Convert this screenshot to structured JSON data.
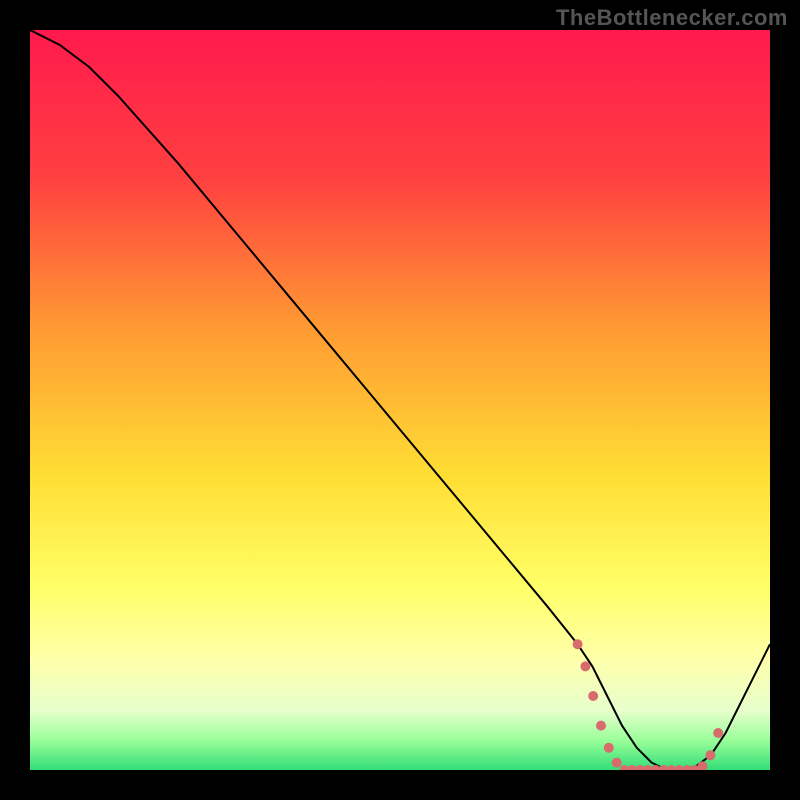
{
  "watermark": "TheBottlenecker.com",
  "chart_data": {
    "type": "line",
    "title": "",
    "xlabel": "",
    "ylabel": "",
    "xlim": [
      0,
      100
    ],
    "ylim": [
      0,
      100
    ],
    "series": [
      {
        "name": "curve",
        "x": [
          0,
          4,
          8,
          12,
          20,
          30,
          40,
          50,
          60,
          70,
          74,
          76,
          78,
          80,
          82,
          84,
          86,
          88,
          90,
          92,
          94,
          100
        ],
        "values": [
          100,
          98,
          95,
          91,
          82,
          70,
          58,
          46,
          34,
          22,
          17,
          14,
          10,
          6,
          3,
          1,
          0,
          0,
          0.5,
          2,
          5,
          17
        ]
      }
    ],
    "threshold_markers": {
      "x_range": [
        74,
        93
      ],
      "y_values": [
        17,
        14,
        10,
        6,
        3,
        1,
        0,
        0,
        0,
        0,
        0,
        0,
        0,
        0,
        0,
        0,
        0.5,
        2,
        5
      ]
    },
    "gradient_stops": [
      {
        "offset": 0,
        "color": "#ff1a4d"
      },
      {
        "offset": 20,
        "color": "#ff4040"
      },
      {
        "offset": 40,
        "color": "#ff9933"
      },
      {
        "offset": 60,
        "color": "#ffdd33"
      },
      {
        "offset": 75,
        "color": "#ffff66"
      },
      {
        "offset": 85,
        "color": "#ffffaa"
      },
      {
        "offset": 92,
        "color": "#e6ffcc"
      },
      {
        "offset": 96,
        "color": "#99ff99"
      },
      {
        "offset": 100,
        "color": "#33dd77"
      }
    ]
  }
}
